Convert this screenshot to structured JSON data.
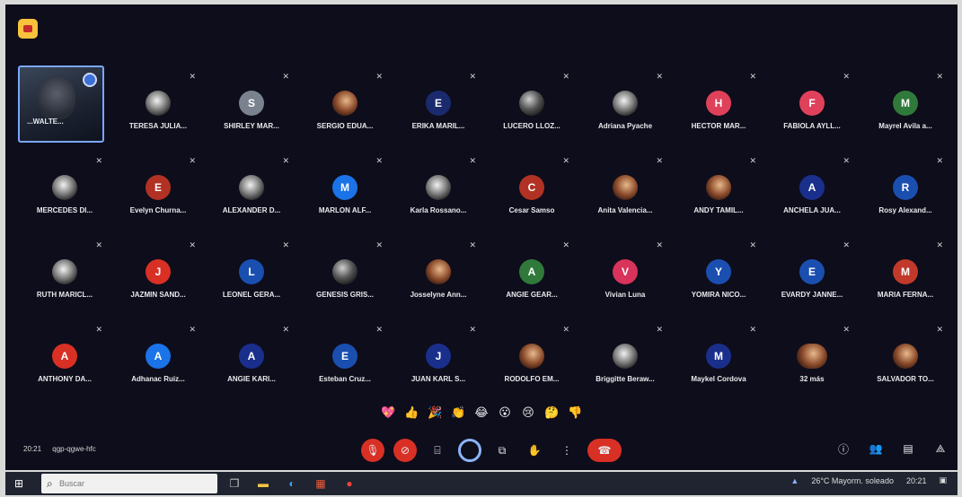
{
  "participants": [
    {
      "name": "...WALTE...",
      "initial": "",
      "color": "",
      "kind": "self"
    },
    {
      "name": "TERESA JULIA...",
      "initial": "",
      "color": "",
      "kind": "photo3"
    },
    {
      "name": "SHIRLEY MAR...",
      "initial": "S",
      "color": "#7a8290"
    },
    {
      "name": "SERGIO EDUA...",
      "initial": "",
      "color": "",
      "kind": "photo2"
    },
    {
      "name": "ERIKA MARIL...",
      "initial": "E",
      "color": "#1a2a6c"
    },
    {
      "name": "LUCERO LLOZ...",
      "initial": "",
      "color": "",
      "kind": "photo"
    },
    {
      "name": "Adriana Pyache",
      "initial": "",
      "color": "",
      "kind": "photo3"
    },
    {
      "name": "HECTOR MAR...",
      "initial": "H",
      "color": "#e0415a"
    },
    {
      "name": "FABIOLA AYLL...",
      "initial": "F",
      "color": "#e0415a"
    },
    {
      "name": "Mayrel Avila a...",
      "initial": "M",
      "color": "#2f7a3a"
    },
    {
      "name": "MERCEDES DI...",
      "initial": "",
      "color": "",
      "kind": "photo3"
    },
    {
      "name": "Evelyn Churna...",
      "initial": "E",
      "color": "#b13224"
    },
    {
      "name": "ALEXANDER D...",
      "initial": "",
      "color": "",
      "kind": "photo3"
    },
    {
      "name": "MARLON ALF...",
      "initial": "M",
      "color": "#1a73e8"
    },
    {
      "name": "Karla Rossano...",
      "initial": "",
      "color": "",
      "kind": "photo3"
    },
    {
      "name": "Cesar Samso",
      "initial": "C",
      "color": "#b13224"
    },
    {
      "name": "Anita Valencia...",
      "initial": "",
      "color": "",
      "kind": "photo2"
    },
    {
      "name": "ANDY TAMIL...",
      "initial": "",
      "color": "",
      "kind": "photo2"
    },
    {
      "name": "ANCHELA JUA...",
      "initial": "A",
      "color": "#1a2f8c"
    },
    {
      "name": "Rosy Alexand...",
      "initial": "R",
      "color": "#1a4fb0"
    },
    {
      "name": "RUTH MARICL...",
      "initial": "",
      "color": "",
      "kind": "photo3"
    },
    {
      "name": "JAZMIN SAND...",
      "initial": "J",
      "color": "#d93025"
    },
    {
      "name": "LEONEL GERA...",
      "initial": "L",
      "color": "#1a4fb0"
    },
    {
      "name": "GENESIS GRIS...",
      "initial": "",
      "color": "",
      "kind": "photo"
    },
    {
      "name": "Josselyne Ann...",
      "initial": "",
      "color": "",
      "kind": "photo2"
    },
    {
      "name": "ANGIE GEAR...",
      "initial": "A",
      "color": "#2f7a3a"
    },
    {
      "name": "Vivian Luna",
      "initial": "V",
      "color": "#d8335a"
    },
    {
      "name": "YOMIRA NICO...",
      "initial": "Y",
      "color": "#1a4fb0"
    },
    {
      "name": "EVARDY JANNE...",
      "initial": "E",
      "color": "#1a4fb0"
    },
    {
      "name": "MARIA FERNA...",
      "initial": "M",
      "color": "#c0392b"
    },
    {
      "name": "ANTHONY DA...",
      "initial": "A",
      "color": "#d93025"
    },
    {
      "name": "Adhanac Ruiz...",
      "initial": "A",
      "color": "#1a73e8"
    },
    {
      "name": "ANGIE KARI...",
      "initial": "A",
      "color": "#1a2f8c"
    },
    {
      "name": "Esteban Cruz...",
      "initial": "E",
      "color": "#1a4fb0"
    },
    {
      "name": "JUAN KARL S...",
      "initial": "J",
      "color": "#1a2f8c"
    },
    {
      "name": "RODOLFO EM...",
      "initial": "",
      "color": "",
      "kind": "photo2"
    },
    {
      "name": "Briggitte Beraw...",
      "initial": "",
      "color": "",
      "kind": "photo3"
    },
    {
      "name": "Maykel Cordova",
      "initial": "M",
      "color": "#1a2f8c"
    },
    {
      "name": "32 más",
      "initial": "",
      "color": "",
      "kind": "more"
    },
    {
      "name": "SALVADOR TO...",
      "initial": "",
      "color": "",
      "kind": "photo2"
    }
  ],
  "reactions": [
    "💖",
    "👍",
    "🎉",
    "👏",
    "😂",
    "😮",
    "😢",
    "🤔",
    "👎"
  ],
  "meeting": {
    "time": "20:21",
    "code": "qgp-qgwe-hfc"
  },
  "taskbar": {
    "search_placeholder": "Buscar"
  },
  "tray": {
    "weather": "26°C Mayorm. soleado",
    "clock": "20:21"
  },
  "colors": {
    "background": "#0e0d1b",
    "end_call": "#d93025",
    "accent": "#8ab4f8"
  }
}
